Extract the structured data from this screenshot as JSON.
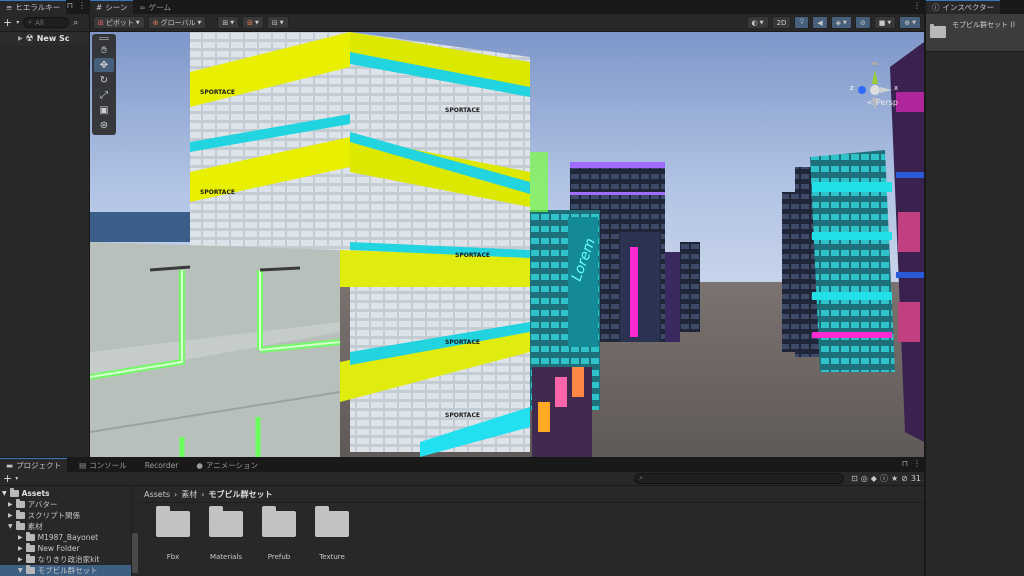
{
  "hierarchy": {
    "tab_label": "ヒエラルキー",
    "search_placeholder": "All",
    "root_item": "New Sc"
  },
  "scene_view": {
    "tabs": [
      {
        "label": "シーン"
      },
      {
        "label": "ゲーム"
      }
    ],
    "pivot_label": "ピボット",
    "global_label": "グローバル",
    "mode_2d": "2D",
    "persp_label": "< Persp",
    "axis_z": "z",
    "axis_x": "x",
    "sign_text": "SPORTACE",
    "colors": {
      "sky": "#9fb7e2",
      "ground": "#6e6866",
      "neon_yellow": "#e8f000",
      "neon_cyan": "#18e0e8",
      "neon_pink": "#ff2ad0"
    }
  },
  "inspector": {
    "tab_label": "インスペクター",
    "selected_name": "モブビル群セット (l"
  },
  "project": {
    "tabs": [
      {
        "label": "プロジェクト"
      },
      {
        "label": "コンソール"
      },
      {
        "label": "Recorder"
      },
      {
        "label": "アニメーション"
      }
    ],
    "breadcrumb": [
      "Assets",
      "素材",
      "モブビル群セット"
    ],
    "badge_count": "31",
    "tree": [
      {
        "label": "Assets"
      },
      {
        "label": "アバター"
      },
      {
        "label": "スクリプト関係"
      },
      {
        "label": "素材"
      },
      {
        "label": "M1987_Bayonet"
      },
      {
        "label": "New Folder"
      },
      {
        "label": "なりきり政治家kit"
      },
      {
        "label": "モブビル群セット"
      }
    ],
    "assets": [
      {
        "name": "Fbx"
      },
      {
        "name": "Materials"
      },
      {
        "name": "Prefub"
      },
      {
        "name": "Texture"
      }
    ]
  }
}
